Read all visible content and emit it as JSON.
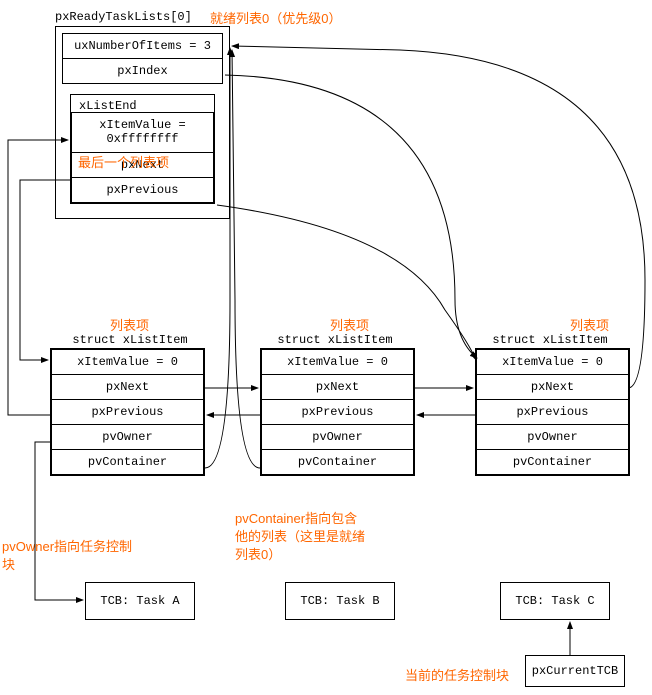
{
  "topTitle": "pxReadyTaskLists[0]",
  "topLabel": "就绪列表0（优先级0）",
  "listBox": {
    "uxNumberOfItems": "uxNumberOfItems = 3",
    "pxIndex": "pxIndex",
    "xListEnd": {
      "title": "xListEnd",
      "xItemValue": "xItemValue =\n0xffffffff",
      "pxNext": "pxNext",
      "pxPrevious": "pxPrevious"
    }
  },
  "lastItemLabel": "最后一个列表项",
  "listItemLabel": "列表项",
  "structTitle": "struct xListItem",
  "listItem": {
    "xItemValue": "xItemValue = 0",
    "pxNext": "pxNext",
    "pxPrevious": "pxPrevious",
    "pvOwner": "pvOwner",
    "pvContainer": "pvContainer"
  },
  "pvOwnerNote": "pvOwner指向任务控制\n块",
  "pvContainerNote": "pvContainer指向包含\n他的列表（这里是就绪\n列表0）",
  "tcb": {
    "a": "TCB: Task A",
    "b": "TCB: Task B",
    "c": "TCB: Task C"
  },
  "currentTCBLabel": "当前的任务控制块",
  "pxCurrentTCB": "pxCurrentTCB"
}
